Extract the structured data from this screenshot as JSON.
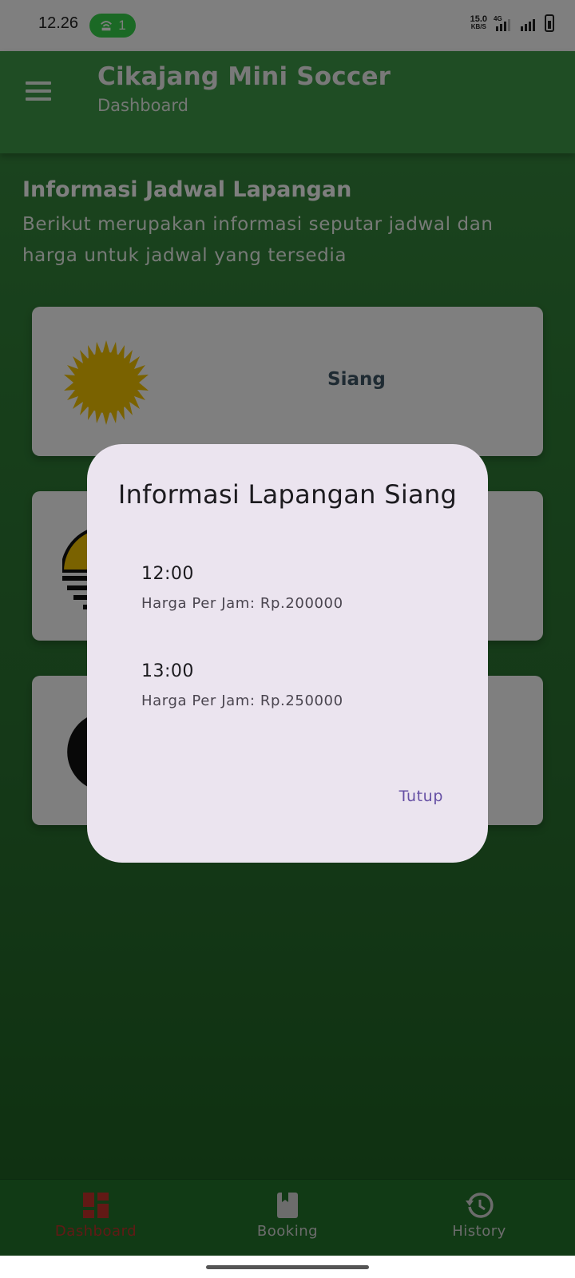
{
  "status_bar": {
    "time": "12.26",
    "hotspot_count": "1",
    "net_speed": "15.0",
    "net_unit": "KB/S",
    "network_type": "4G"
  },
  "app_bar": {
    "title": "Cikajang Mini Soccer",
    "subtitle": "Dashboard"
  },
  "main": {
    "section_title": "Informasi Jadwal Lapangan",
    "section_description": "Berikut merupakan informasi seputar jadwal dan harga untuk jadwal yang tersedia",
    "cards": [
      {
        "label": "Siang",
        "icon": "sun-icon"
      },
      {
        "label": "",
        "icon": "sunset-icon"
      },
      {
        "label": "",
        "icon": "moon-icon"
      }
    ]
  },
  "dialog": {
    "title": "Informasi Lapangan Siang",
    "slots": [
      {
        "time": "12:00",
        "price": "Harga Per Jam: Rp.200000"
      },
      {
        "time": "13:00",
        "price": "Harga Per Jam: Rp.250000"
      }
    ],
    "close_label": "Tutup"
  },
  "bottom_nav": {
    "items": [
      {
        "label": "Dashboard",
        "icon": "dashboard-icon",
        "active": true
      },
      {
        "label": "Booking",
        "icon": "book-icon",
        "active": false
      },
      {
        "label": "History",
        "icon": "history-icon",
        "active": false
      }
    ]
  },
  "colors": {
    "primary_green": "#3e9a48",
    "active_nav": "#c5322b",
    "dialog_bg": "#ebe4ef",
    "dialog_action": "#6650a4",
    "sun": "#f5c400"
  }
}
